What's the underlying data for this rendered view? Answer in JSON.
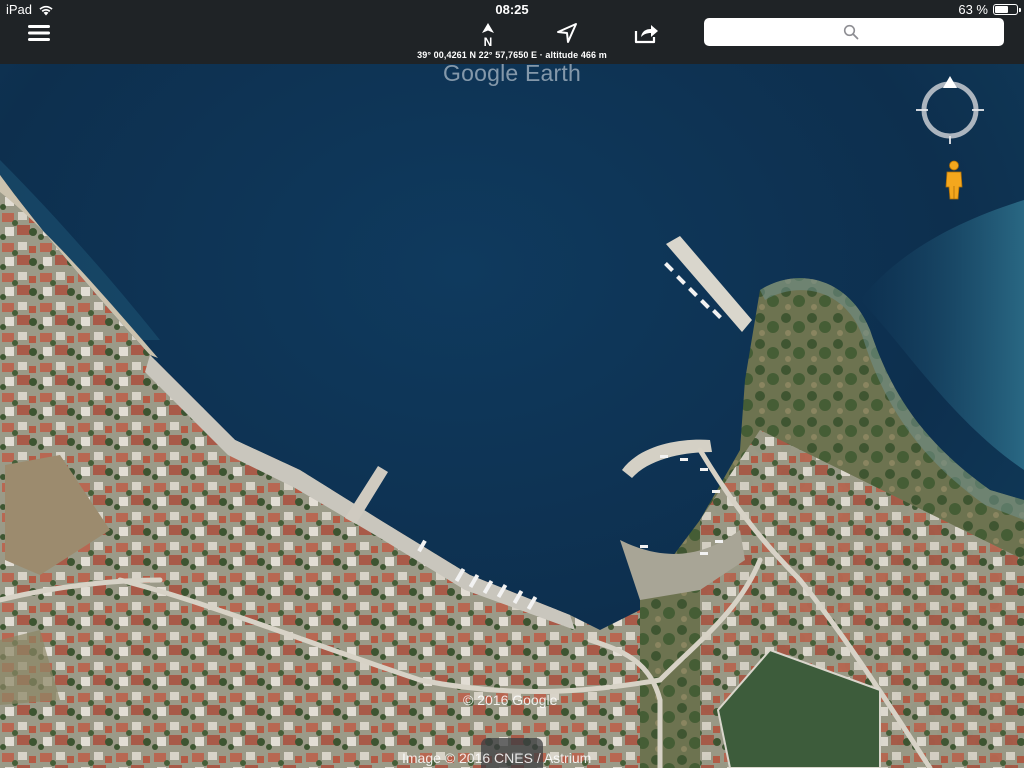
{
  "status_bar": {
    "device": "iPad",
    "time": "08:25",
    "battery": "63 %",
    "battery_level": 0.63
  },
  "toolbar": {
    "coordinates": "39° 00,4261 N  22° 57,7650 E · altitude 466 m",
    "search_placeholder": "",
    "north_letter": "N",
    "icons": {
      "menu": "hamburger-icon",
      "north": "north-arrow-icon",
      "locate": "location-arrow-icon",
      "share": "share-icon",
      "search": "search-icon"
    }
  },
  "map": {
    "watermark": "Google Earth",
    "copyright": "© 2016 Google",
    "imagery_credit": "Image © 2016 CNES / Astrium",
    "icons": {
      "compass": "compass-icon",
      "street_view": "pegman-icon"
    }
  },
  "colors": {
    "toolbar_bg": "#1f2326",
    "sea_deep": "#0d2f4e",
    "sea_shallow": "#2e6a86",
    "pegman": "#f4a71d"
  }
}
